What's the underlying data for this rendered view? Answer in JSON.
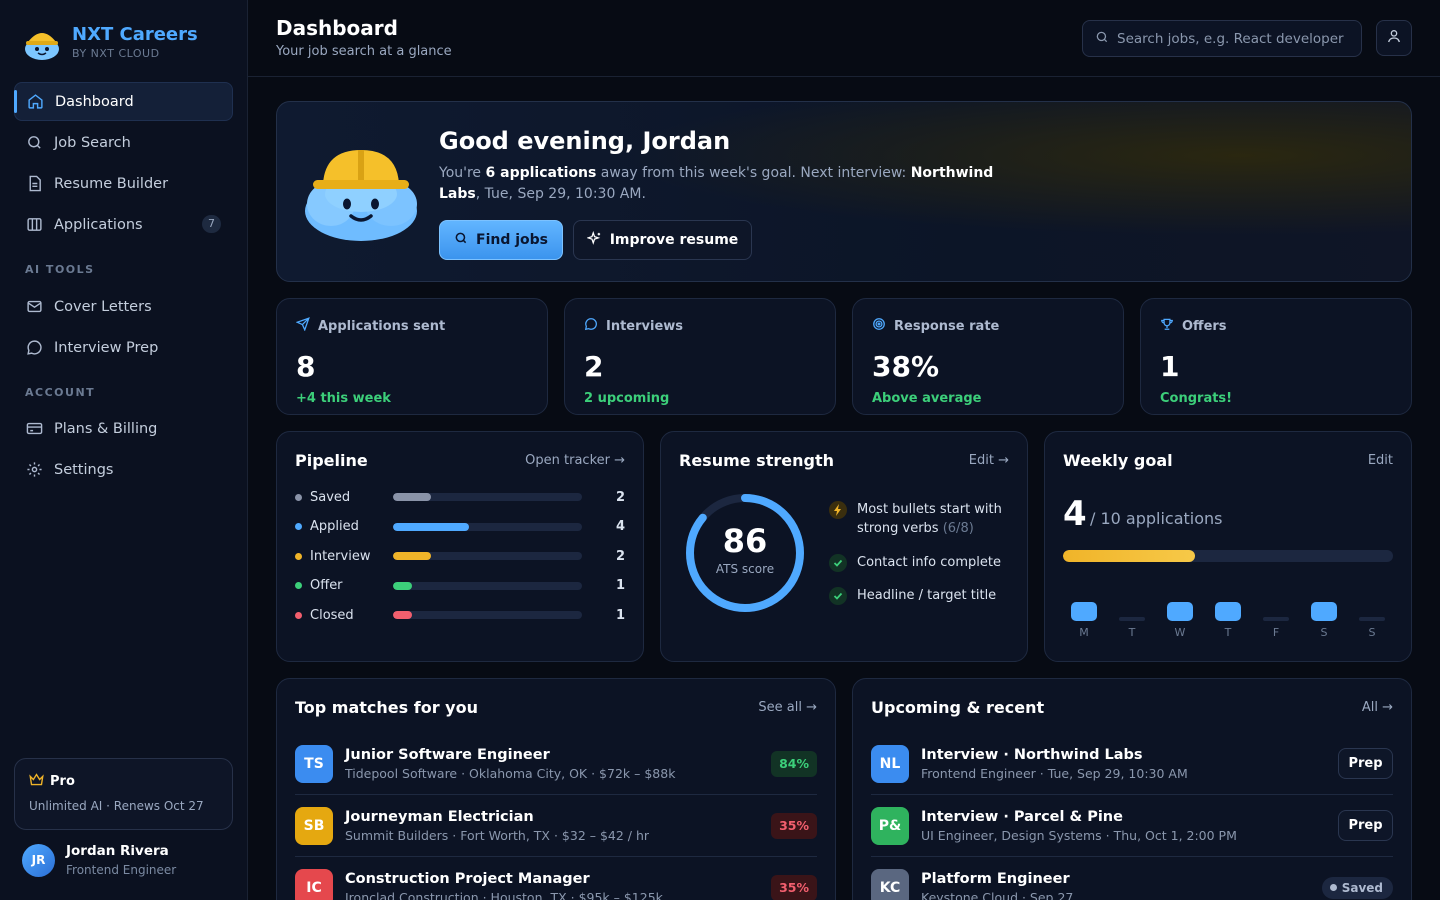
{
  "brand": {
    "name": "NXT Careers",
    "sub": "BY NXT CLOUD"
  },
  "sidebar": {
    "items": [
      {
        "label": "Dashboard",
        "icon": "home-icon"
      },
      {
        "label": "Job Search",
        "icon": "search-icon"
      },
      {
        "label": "Resume Builder",
        "icon": "document-icon"
      },
      {
        "label": "Applications",
        "icon": "columns-icon",
        "badge": "7"
      }
    ],
    "ai_section": "AI TOOLS",
    "ai_items": [
      {
        "label": "Cover Letters",
        "icon": "mail-icon"
      },
      {
        "label": "Interview Prep",
        "icon": "chat-icon"
      }
    ],
    "account_section": "ACCOUNT",
    "account_items": [
      {
        "label": "Plans & Billing",
        "icon": "credit-card-icon"
      },
      {
        "label": "Settings",
        "icon": "gear-icon"
      }
    ],
    "pro": {
      "title": "Pro",
      "sub": "Unlimited AI · Renews Oct 27"
    },
    "user": {
      "initials": "JR",
      "name": "Jordan Rivera",
      "role": "Frontend Engineer"
    }
  },
  "header": {
    "title": "Dashboard",
    "subtitle": "Your job search at a glance",
    "search_placeholder": "Search jobs, e.g. React developer"
  },
  "hero": {
    "greeting": "Good evening, Jordan",
    "text_1": "You're ",
    "apps_count": "6 applications",
    "text_2": " away from this week's goal. Next interview: ",
    "company": "Northwind Labs",
    "text_3": ", Tue, Sep 29, 10:30 AM.",
    "primary_btn": "Find jobs",
    "secondary_btn": "Improve resume"
  },
  "stats": [
    {
      "label": "Applications sent",
      "value": "8",
      "note": "+4 this week",
      "icon": "send-icon"
    },
    {
      "label": "Interviews",
      "value": "2",
      "note": "2 upcoming",
      "icon": "chat-icon"
    },
    {
      "label": "Response rate",
      "value": "38%",
      "note": "Above average",
      "icon": "target-icon"
    },
    {
      "label": "Offers",
      "value": "1",
      "note": "Congrats!",
      "icon": "trophy-icon"
    }
  ],
  "pipeline": {
    "title": "Pipeline",
    "link": "Open tracker →",
    "rows": [
      {
        "label": "Saved",
        "count": 2,
        "color": "#8a93a8"
      },
      {
        "label": "Applied",
        "count": 4,
        "color": "#4fa9ff"
      },
      {
        "label": "Interview",
        "count": 2,
        "color": "#f0b429"
      },
      {
        "label": "Offer",
        "count": 1,
        "color": "#3ccf7a"
      },
      {
        "label": "Closed",
        "count": 1,
        "color": "#f25f6e"
      }
    ]
  },
  "resume": {
    "title": "Resume strength",
    "link": "Edit →",
    "score": "86",
    "score_value": 86,
    "score_label": "ATS score",
    "checks": [
      {
        "text": "Most bullets start with strong verbs",
        "muted": "(6/8)",
        "status": "warning"
      },
      {
        "text": "Contact info complete",
        "muted": "",
        "status": "ok"
      },
      {
        "text": "Headline / target title",
        "muted": "",
        "status": "ok"
      }
    ]
  },
  "weekly": {
    "title": "Weekly goal",
    "link": "Edit",
    "done": "4",
    "of_text": "/ 10 applications",
    "progress": 0.4,
    "days": [
      {
        "label": "M",
        "active": true
      },
      {
        "label": "T",
        "active": false
      },
      {
        "label": "W",
        "active": true
      },
      {
        "label": "T",
        "active": true
      },
      {
        "label": "F",
        "active": false
      },
      {
        "label": "S",
        "active": true
      },
      {
        "label": "S",
        "active": false
      }
    ]
  },
  "matches": {
    "title": "Top matches for you",
    "link": "See all →",
    "items": [
      {
        "initials": "TS",
        "color": "#3b8cf0",
        "title": "Junior Software Engineer",
        "sub": "Tidepool Software · Oklahoma City, OK · $72k – $88k",
        "score": "84%",
        "level": "high"
      },
      {
        "initials": "SB",
        "color": "#e5a810",
        "title": "Journeyman Electrician",
        "sub": "Summit Builders · Fort Worth, TX · $32 – $42 / hr",
        "score": "35%",
        "level": "low"
      },
      {
        "initials": "IC",
        "color": "#e5484d",
        "title": "Construction Project Manager",
        "sub": "Ironclad Construction · Houston, TX · $95k – $125k",
        "score": "35%",
        "level": "low"
      }
    ]
  },
  "upcoming": {
    "title": "Upcoming & recent",
    "link": "All →",
    "items": [
      {
        "initials": "NL",
        "color": "#3b8cf0",
        "title": "Interview · Northwind Labs",
        "sub": "Frontend Engineer · Tue, Sep 29, 10:30 AM",
        "action": "Prep"
      },
      {
        "initials": "P&",
        "color": "#2fb35e",
        "title": "Interview · Parcel & Pine",
        "sub": "UI Engineer, Design Systems · Thu, Oct 1, 2:00 PM",
        "action": "Prep"
      },
      {
        "initials": "KC",
        "color": "#5a6780",
        "title": "Platform Engineer",
        "sub": "Keystone Cloud · Sep 27",
        "action": "Saved"
      }
    ]
  }
}
